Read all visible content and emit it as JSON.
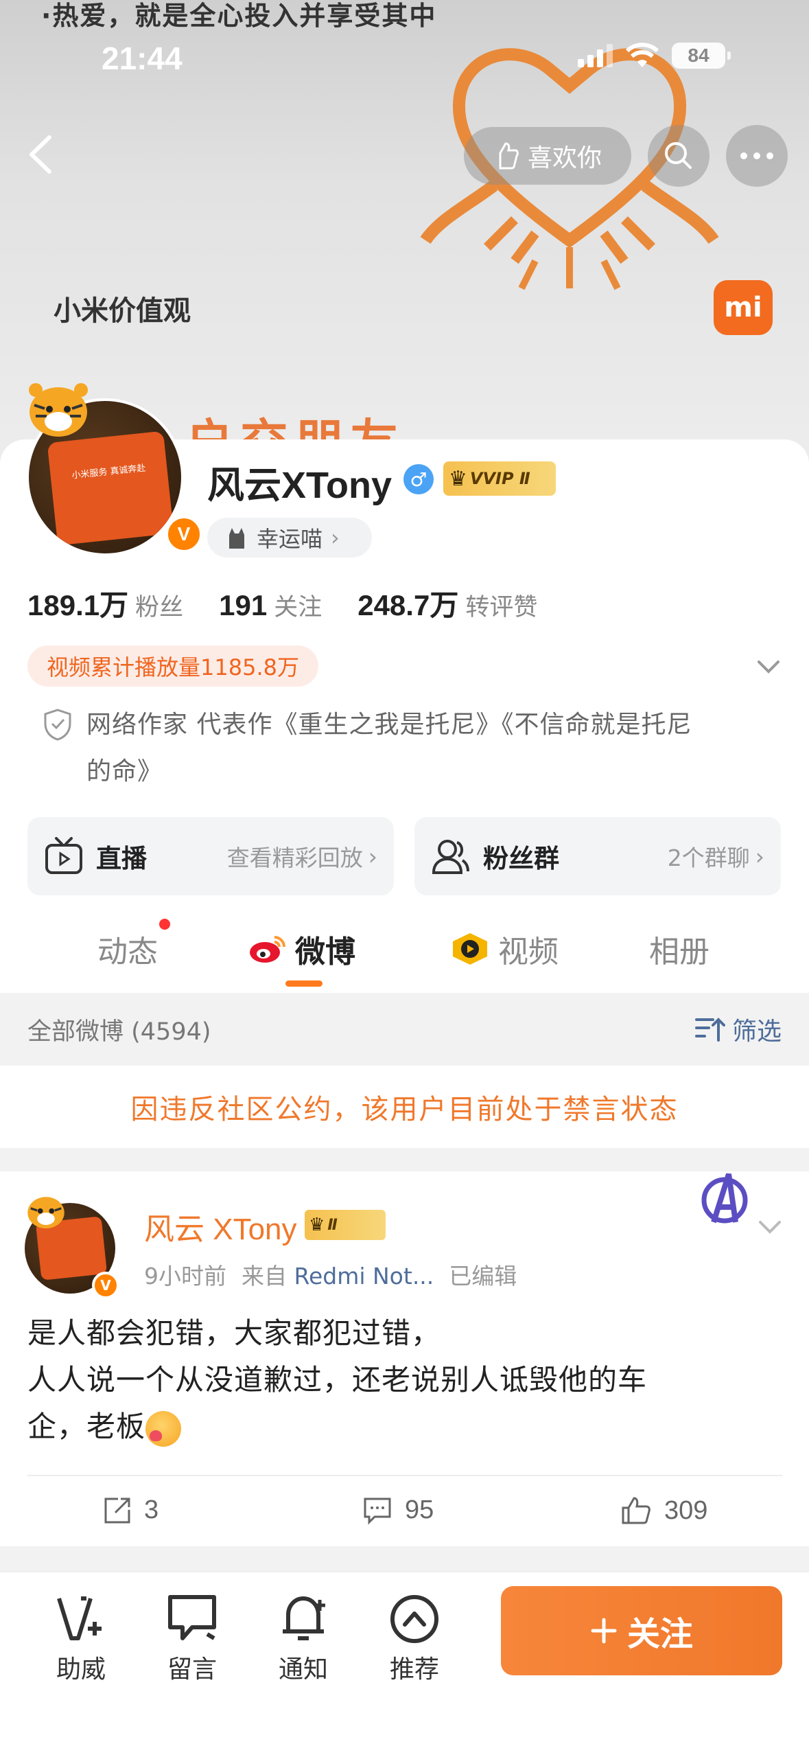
{
  "banner": {
    "top_line": "·热爱，就是全心投入并享受其中",
    "value_label": "小米价值观",
    "orange_text": "户交朋友",
    "mi_logo": "mi"
  },
  "status_bar": {
    "time": "21:44",
    "battery": "84"
  },
  "nav": {
    "like_label": "喜欢你"
  },
  "profile": {
    "name": "风云XTony",
    "vip_label": "VVIP Ⅱ",
    "lucky_label": "幸运喵",
    "avatar_text": "小米服务 真诚奔赴",
    "verified_mark": "V",
    "stats": [
      {
        "num": "189.1万",
        "label": "粉丝"
      },
      {
        "num": "191",
        "label": "关注"
      },
      {
        "num": "248.7万",
        "label": "转评赞"
      }
    ],
    "video_views": "视频累计播放量1185.8万",
    "bio_line1": "网络作家 代表作《重生之我是托尼》《不信命就是托尼",
    "bio_line2": "的命》"
  },
  "features": {
    "live": {
      "title": "直播",
      "sub": "查看精彩回放"
    },
    "fans": {
      "title": "粉丝群",
      "sub": "2个群聊"
    }
  },
  "tabs": [
    "动态",
    "微博",
    "视频",
    "相册"
  ],
  "filter": {
    "all_label": "全部微博 (4594)",
    "filter_label": "筛选"
  },
  "ban_notice": "因违反社区公约，该用户目前处于禁言状态",
  "post": {
    "name": "风云 XTony",
    "badge": "Ⅱ",
    "time": "9小时前",
    "source": "来自",
    "device": "Redmi Not...",
    "edited": "已编辑",
    "line1": "是人都会犯错，大家都犯过错，",
    "line2": "人人说一个从没道歉过，还老说别人诋毁他的车",
    "line3": "企，老板",
    "reposts": "3",
    "comments": "95",
    "likes": "309"
  },
  "bottom_bar": {
    "items": [
      "助威",
      "留言",
      "通知",
      "推荐"
    ],
    "follow_label": "关注"
  },
  "colors": {
    "accent": "#f0782b",
    "link": "#4e6d9a",
    "verified": "#ff8200"
  },
  "icons": [
    "back-icon",
    "like-hand-icon",
    "search-icon",
    "more-icon",
    "gender-male-icon",
    "cat-icon",
    "chevron-right-icon",
    "chevron-down-icon",
    "shield-icon",
    "tv-icon",
    "group-icon",
    "weibo-icon",
    "video-icon",
    "filter-icon",
    "avengers-icon",
    "repost-icon",
    "comment-icon",
    "like-icon",
    "cheer-icon",
    "message-icon",
    "bell-icon",
    "recommend-icon",
    "plus-icon"
  ]
}
